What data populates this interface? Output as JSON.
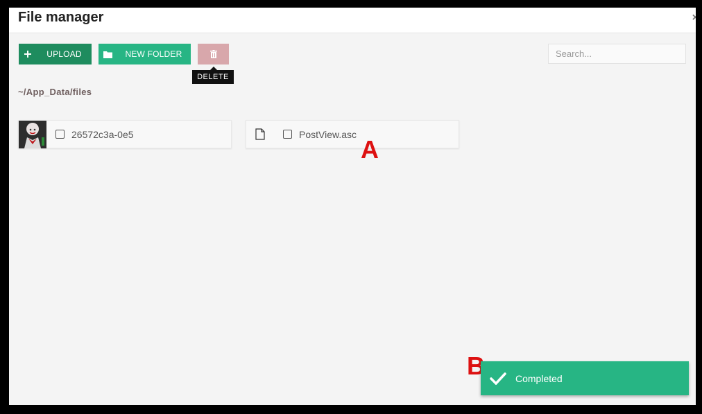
{
  "modal": {
    "title": "File manager",
    "close_label": "×"
  },
  "toolbar": {
    "upload_label": "UPLOAD",
    "new_folder_label": "NEW FOLDER",
    "delete_tooltip": "DELETE",
    "upload_icon": "plus-icon",
    "new_folder_icon": "folder-icon",
    "delete_icon": "trash-icon"
  },
  "search": {
    "placeholder": "Search...",
    "value": ""
  },
  "path": "~/App_Data/files",
  "files": [
    {
      "name": "26572c3a-0e5",
      "type": "image",
      "checked": false
    },
    {
      "name": "PostView.asc",
      "type": "document",
      "checked": false
    }
  ],
  "annotations": {
    "a": "A",
    "b": "B"
  },
  "toast": {
    "message": "Completed",
    "icon": "check-icon"
  },
  "colors": {
    "upload_button": "#1e8c5e",
    "new_folder_button": "#27b584",
    "delete_button": "#d8a7ab",
    "toast": "#27b584",
    "annotation": "#dd1111"
  }
}
